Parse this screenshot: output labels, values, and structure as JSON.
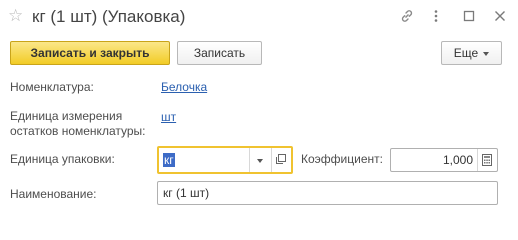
{
  "window": {
    "title": "кг (1 шт) (Упаковка)",
    "icons": {
      "favorite": "star-icon",
      "link": "link-icon",
      "more": "kebab-icon",
      "maximize": "maximize-icon",
      "close": "close-icon"
    }
  },
  "toolbar": {
    "save_close_label": "Записать и закрыть",
    "save_label": "Записать",
    "more_label": "Еще"
  },
  "form": {
    "nomenclature": {
      "label": "Номенклатура:",
      "value": "Белочка"
    },
    "unit": {
      "label_line1": "Единица измерения",
      "label_line2": "остатков номенклатуры:",
      "value": "шт"
    },
    "package_unit": {
      "label": "Единица упаковки:",
      "value": "кг"
    },
    "coefficient": {
      "label": "Коэффициент:",
      "value": "1,000"
    },
    "name": {
      "label": "Наименование:",
      "value": "кг (1 шт)"
    }
  },
  "colors": {
    "accent": "#f2cc26",
    "link": "#2b60b0",
    "selection": "#3d6bc7"
  }
}
